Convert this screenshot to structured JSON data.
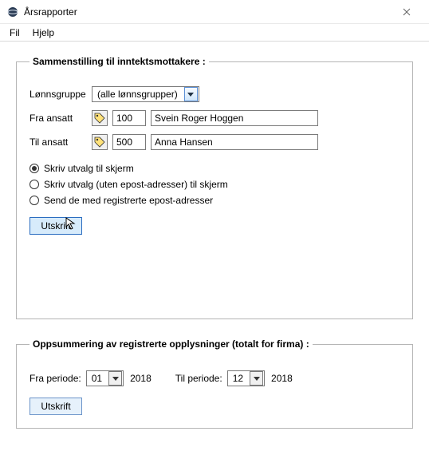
{
  "window": {
    "title": "Årsrapporter"
  },
  "menu": {
    "file": "Fil",
    "help": "Hjelp"
  },
  "group1": {
    "legend": "Sammenstilling til inntektsmottakere  :",
    "lonnsgruppe_label": "Lønnsgruppe",
    "lonnsgruppe_value": "(alle lønnsgrupper)",
    "fra_ansatt_label": "Fra ansatt",
    "fra_ansatt_num": "100",
    "fra_ansatt_name": "Svein Roger Hoggen",
    "til_ansatt_label": "Til ansatt",
    "til_ansatt_num": "500",
    "til_ansatt_name": "Anna Hansen",
    "radio1": "Skriv utvalg til skjerm",
    "radio2": "Skriv utvalg (uten epost-adresser) til skjerm",
    "radio3": "Send de med registrerte epost-adresser",
    "print_btn": "Utskrift"
  },
  "group2": {
    "legend": "Oppsummering av registrerte opplysninger (totalt for firma)  :",
    "fra_periode_label": "Fra periode:",
    "fra_periode_value": "01",
    "fra_year": "2018",
    "til_periode_label": "Til periode:",
    "til_periode_value": "12",
    "til_year": "2018",
    "print_btn": "Utskrift"
  }
}
